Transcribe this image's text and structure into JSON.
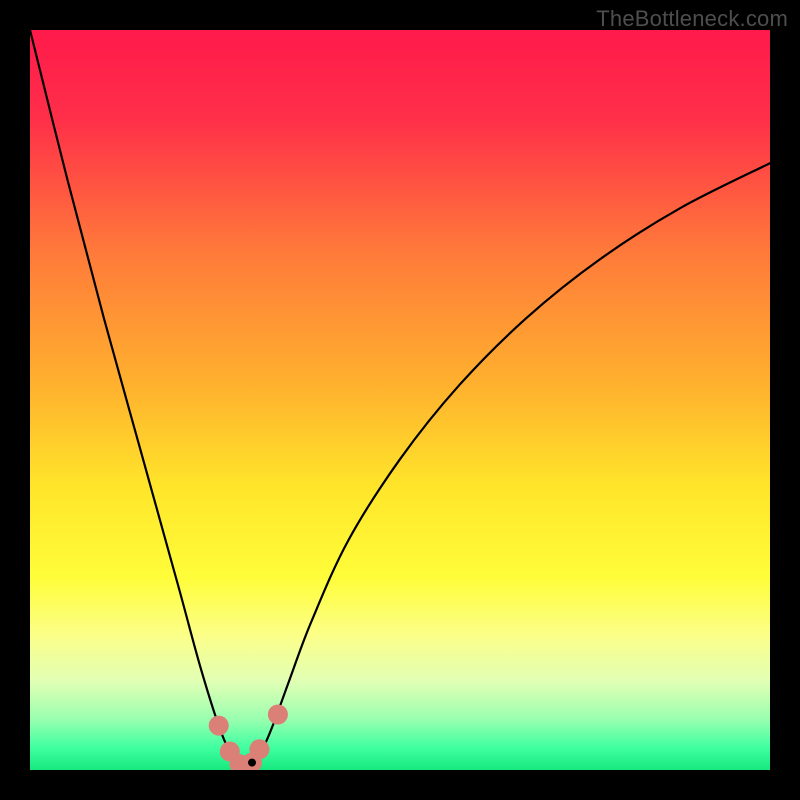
{
  "watermark": "TheBottleneck.com",
  "chart_data": {
    "type": "line",
    "title": "",
    "xlabel": "",
    "ylabel": "",
    "xlim": [
      0,
      1
    ],
    "ylim": [
      0,
      1
    ],
    "gradient_stops": [
      {
        "offset": 0.0,
        "color": "#ff1a4b"
      },
      {
        "offset": 0.12,
        "color": "#ff2f49"
      },
      {
        "offset": 0.3,
        "color": "#ff7a3a"
      },
      {
        "offset": 0.48,
        "color": "#ffb12e"
      },
      {
        "offset": 0.62,
        "color": "#ffe62a"
      },
      {
        "offset": 0.74,
        "color": "#fffd3a"
      },
      {
        "offset": 0.82,
        "color": "#fbff8a"
      },
      {
        "offset": 0.88,
        "color": "#e1ffb4"
      },
      {
        "offset": 0.93,
        "color": "#9cffb0"
      },
      {
        "offset": 0.97,
        "color": "#3fffa0"
      },
      {
        "offset": 1.0,
        "color": "#17e87e"
      }
    ],
    "series": [
      {
        "name": "bottleneck-curve",
        "x": [
          0.0,
          0.05,
          0.1,
          0.15,
          0.2,
          0.23,
          0.255,
          0.27,
          0.283,
          0.293,
          0.3,
          0.315,
          0.33,
          0.35,
          0.38,
          0.43,
          0.5,
          0.58,
          0.67,
          0.77,
          0.88,
          1.0
        ],
        "values": [
          1.0,
          0.8,
          0.61,
          0.43,
          0.25,
          0.14,
          0.06,
          0.025,
          0.008,
          0.003,
          0.01,
          0.03,
          0.065,
          0.12,
          0.2,
          0.31,
          0.42,
          0.52,
          0.61,
          0.69,
          0.76,
          0.82
        ]
      }
    ],
    "markers": [
      {
        "x": 0.255,
        "y": 0.06,
        "r": 10
      },
      {
        "x": 0.27,
        "y": 0.025,
        "r": 10
      },
      {
        "x": 0.283,
        "y": 0.008,
        "r": 10
      },
      {
        "x": 0.293,
        "y": 0.003,
        "r": 10
      },
      {
        "x": 0.3,
        "y": 0.01,
        "r": 10
      },
      {
        "x": 0.31,
        "y": 0.028,
        "r": 10
      },
      {
        "x": 0.335,
        "y": 0.075,
        "r": 10
      }
    ],
    "trough_dot": {
      "x": 0.3,
      "y": 0.01,
      "r": 4
    }
  }
}
